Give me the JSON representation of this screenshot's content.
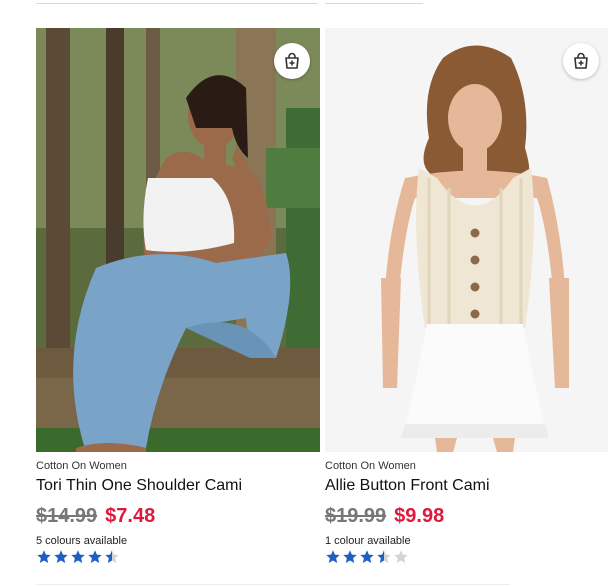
{
  "products": [
    {
      "brand": "Cotton On Women",
      "name": "Tori Thin One Shoulder Cami",
      "was_price": "$14.99",
      "sale_price": "$7.48",
      "colours": "5 colours available",
      "rating_stars": 4.5,
      "add_to_bag_icon": "shopping-bag-plus-icon"
    },
    {
      "brand": "Cotton On Women",
      "name": "Allie Button Front Cami",
      "was_price": "$19.99",
      "sale_price": "$9.98",
      "colours": "1 colour available",
      "rating_stars": 3.5,
      "add_to_bag_icon": "shopping-bag-plus-icon"
    }
  ],
  "colors": {
    "sale_price": "#e0183d",
    "was_price": "#777777",
    "star_fill": "#1f5fc1",
    "star_empty": "#d4d4d4"
  }
}
